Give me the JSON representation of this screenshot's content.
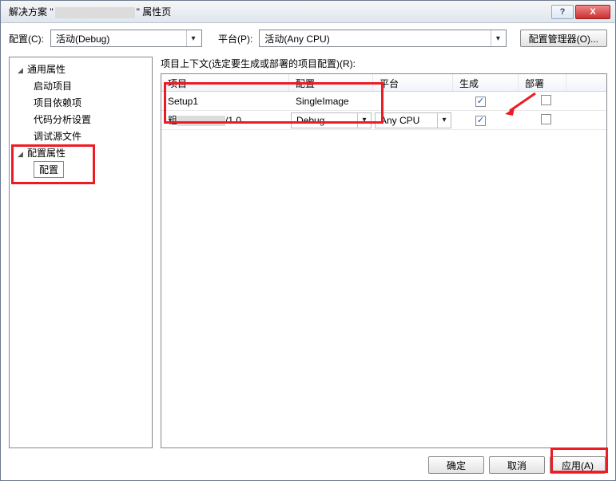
{
  "title": {
    "prefix": "解决方案 \"",
    "suffix": "\" 属性页"
  },
  "win_buttons": {
    "help": "?",
    "close": "X"
  },
  "topbar": {
    "config_label": "配置(C):",
    "config_value": "活动(Debug)",
    "platform_label": "平台(P):",
    "platform_value": "活动(Any CPU)",
    "cfgmgr_label": "配置管理器(O)..."
  },
  "tree": {
    "group1": "通用属性",
    "items1": [
      "启动项目",
      "项目依赖项",
      "代码分析设置",
      "调试源文件"
    ],
    "group2": "配置属性",
    "items2": [
      "配置"
    ]
  },
  "context_label": "项目上下文(选定要生成或部署的项目配置)(R):",
  "columns": {
    "project": "项目",
    "config": "配置",
    "platform": "平台",
    "build": "生成",
    "deploy": "部署"
  },
  "rows": [
    {
      "project": "Setup1",
      "config": "SingleImage",
      "config_combo": false,
      "platform": "",
      "platform_combo": false,
      "build": true,
      "deploy": false,
      "deploy_shown": true
    },
    {
      "project_prefix": "粗",
      "project_suffix": "/1.0",
      "project_redacted": true,
      "config": "Debug",
      "config_combo": true,
      "platform": "Any CPU",
      "platform_combo": true,
      "build": true,
      "deploy": false,
      "deploy_shown": true
    }
  ],
  "footer": {
    "ok": "确定",
    "cancel": "取消",
    "apply": "应用(A)"
  }
}
